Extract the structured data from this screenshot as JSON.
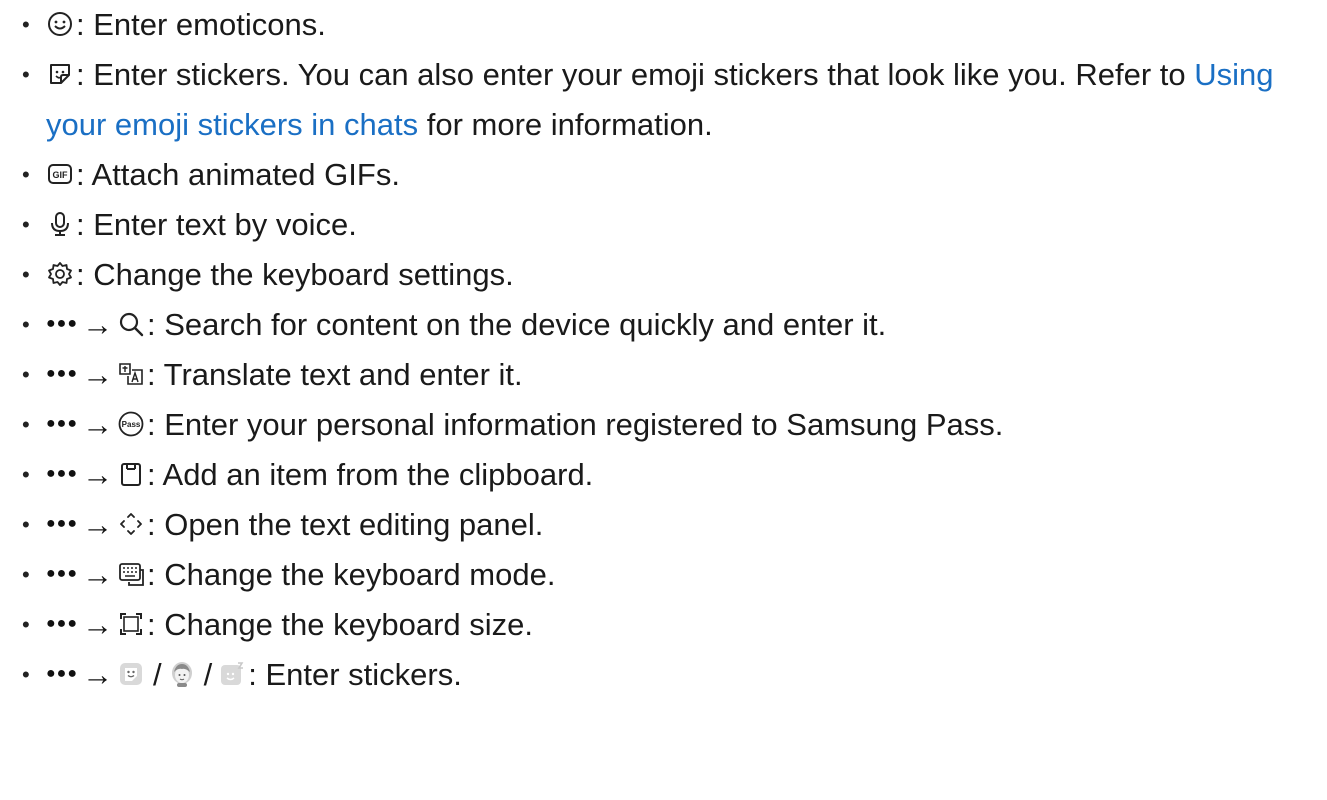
{
  "bullet": "•",
  "more_glyph": "●●●",
  "arrow": "→",
  "separator": "/",
  "link_color": "#1a6fc4",
  "items": [
    {
      "icon": "emoticon-icon",
      "text": ": Enter emoticons."
    },
    {
      "icon": "sticker-icon",
      "text_before": ": Enter stickers. You can also enter your emoji stickers that look like you. Refer to ",
      "link": "Using your emoji stickers in chats",
      "text_after": " for more information."
    },
    {
      "icon": "gif-icon",
      "text": ": Attach animated GIFs."
    },
    {
      "icon": "microphone-icon",
      "text": ": Enter text by voice."
    },
    {
      "icon": "gear-icon",
      "text": ": Change the keyboard settings."
    },
    {
      "icon": "search-icon",
      "text": ": Search for content on the device quickly and enter it."
    },
    {
      "icon": "translate-icon",
      "text": ": Translate text and enter it."
    },
    {
      "icon": "samsung-pass-icon",
      "text": ": Enter your personal information registered to Samsung Pass."
    },
    {
      "icon": "clipboard-icon",
      "text": ": Add an item from the clipboard."
    },
    {
      "icon": "text-editing-icon",
      "text": ": Open the text editing panel."
    },
    {
      "icon": "keyboard-mode-icon",
      "text": ": Change the keyboard mode."
    },
    {
      "icon": "keyboard-size-icon",
      "text": ": Change the keyboard size."
    },
    {
      "icon": "stickers-icons",
      "text": ": Enter stickers."
    }
  ]
}
